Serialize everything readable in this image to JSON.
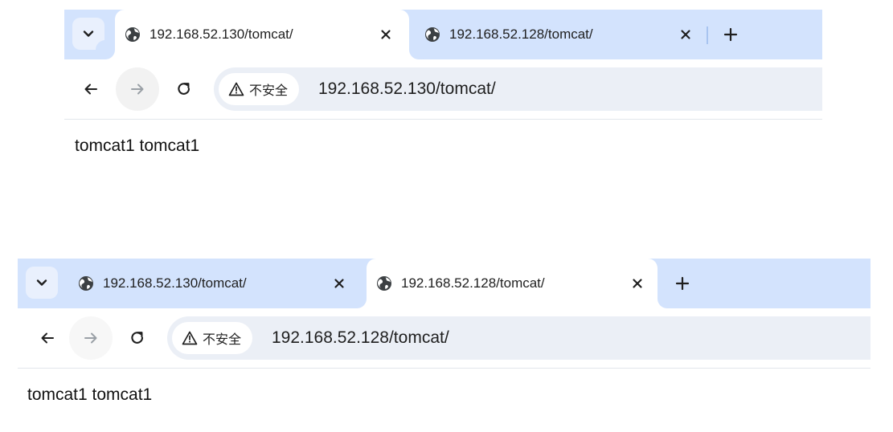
{
  "screenshots": [
    {
      "tabs": [
        {
          "title": "192.168.52.130/tomcat/",
          "active": true
        },
        {
          "title": "192.168.52.128/tomcat/",
          "active": false
        }
      ],
      "security_label": "不安全",
      "url": "192.168.52.130/tomcat/",
      "page_text": "tomcat1 tomcat1",
      "forward_enabled": false
    },
    {
      "tabs": [
        {
          "title": "192.168.52.130/tomcat/",
          "active": false
        },
        {
          "title": "192.168.52.128/tomcat/",
          "active": true
        }
      ],
      "security_label": "不安全",
      "url": "192.168.52.128/tomcat/",
      "page_text": "tomcat1 tomcat1",
      "forward_enabled": false
    }
  ],
  "icons": {
    "tab_search": "chevron-down-icon",
    "favicon": "globe-icon",
    "close": "close-icon",
    "new_tab": "plus-icon",
    "back": "arrow-left-icon",
    "forward": "arrow-right-icon",
    "reload": "reload-icon",
    "security": "warning-triangle-icon"
  },
  "colors": {
    "tabstrip": "#d3e3fd",
    "omnibox": "#ebeff6",
    "icon": "#1f1f1f",
    "disabled_icon": "#9aa0a6"
  }
}
